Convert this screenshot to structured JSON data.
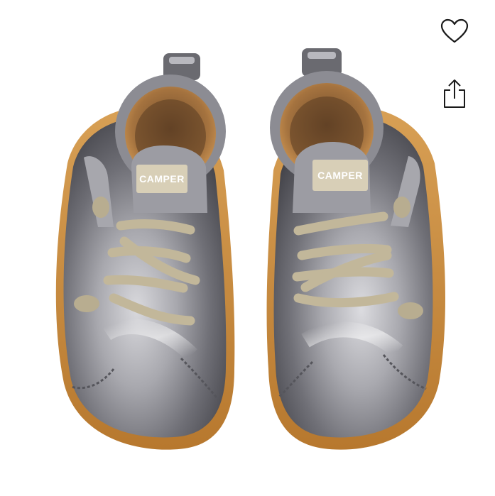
{
  "product": {
    "brand_label_left": "CAMPER",
    "brand_label_right": "CAMPER"
  },
  "actions": {
    "favorite_icon": "heart-outline-icon",
    "share_icon": "share-icon"
  },
  "colors": {
    "leather_silver": "#9a9aa0",
    "sole": "#c98a3c",
    "lining": "#c28a4c",
    "laces": "#c2b79a",
    "icon": "#1a1a1a"
  }
}
